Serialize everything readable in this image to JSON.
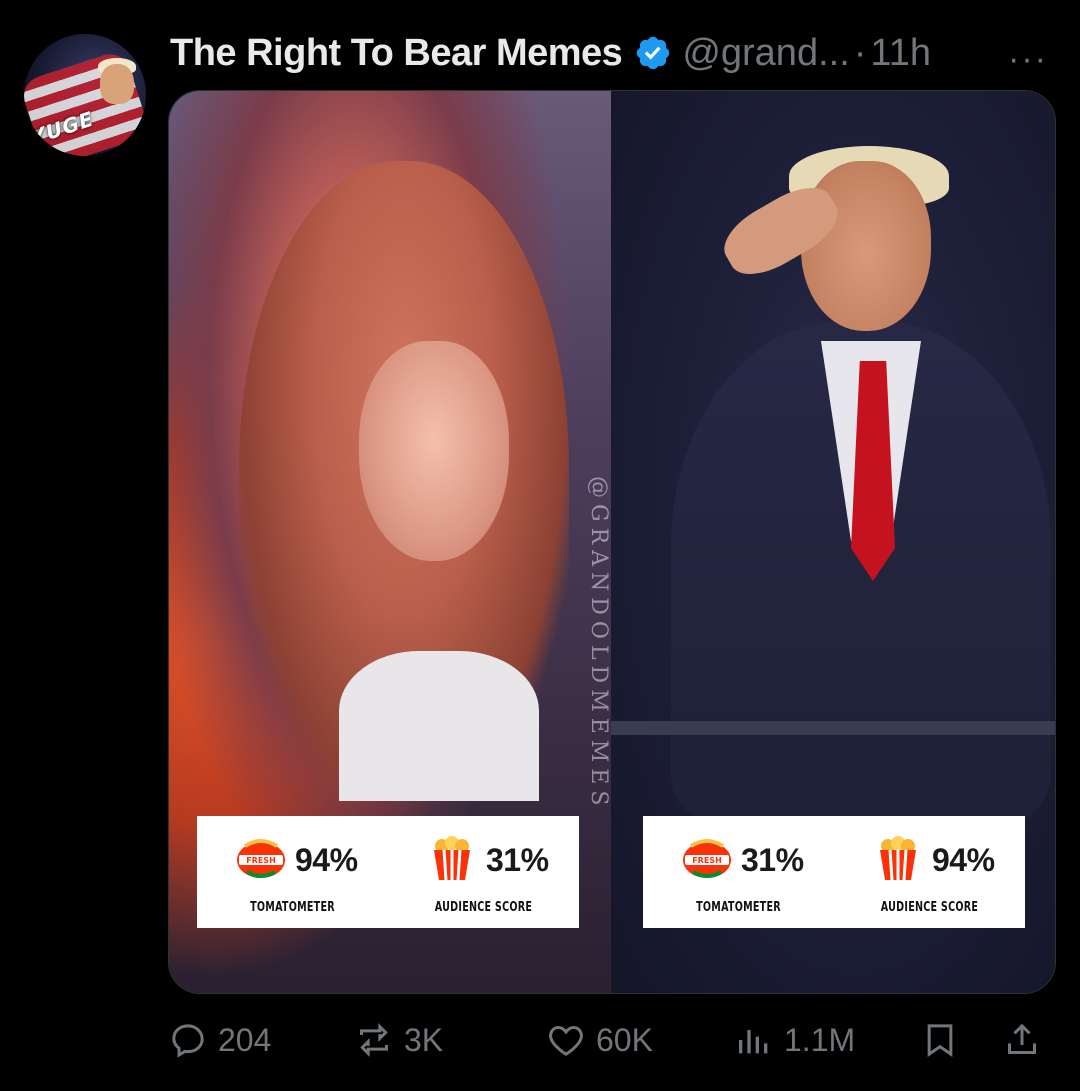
{
  "post": {
    "author": {
      "display_name": "The Right To Bear Memes",
      "handle": "@grand...",
      "separator": "·",
      "time": "11h",
      "verified": true,
      "avatar_text": "YUGE"
    },
    "more_label": "···",
    "media": {
      "watermark": "@GRANDOLDMEMES",
      "panels": [
        {
          "scores": [
            {
              "icon": "certified-fresh-icon",
              "value": "94%",
              "label": "TOMATOMETER"
            },
            {
              "icon": "popcorn-icon",
              "value": "31%",
              "label": "AUDIENCE SCORE"
            }
          ]
        },
        {
          "scores": [
            {
              "icon": "certified-fresh-icon",
              "value": "31%",
              "label": "TOMATOMETER"
            },
            {
              "icon": "popcorn-icon",
              "value": "94%",
              "label": "AUDIENCE SCORE"
            }
          ]
        }
      ]
    },
    "actions": {
      "replies": "204",
      "reposts": "3K",
      "likes": "60K",
      "views": "1.1M"
    }
  },
  "colors": {
    "background": "#000000",
    "text_primary": "#e7e9ea",
    "text_secondary": "#71767b",
    "verified_badge": "#1d9bf0",
    "rt_red": "#fa320a",
    "rt_green": "#00912d"
  }
}
